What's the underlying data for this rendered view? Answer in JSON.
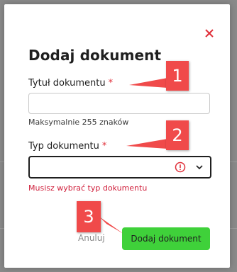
{
  "dialog": {
    "title": "Dodaj dokument",
    "close_icon": "close-icon",
    "fields": {
      "document_title": {
        "label": "Tytuł dokumentu",
        "required_mark": "*",
        "value": "",
        "hint": "Maksymalnie 255 znaków"
      },
      "document_type": {
        "label": "Typ dokumentu",
        "required_mark": "*",
        "selected_value": "",
        "error_icon": "exclamation-circle-icon",
        "dropdown_icon": "chevron-down-icon",
        "error_message": "Musisz wybrać typ dokumentu"
      }
    },
    "actions": {
      "cancel_label": "Anuluj",
      "submit_label": "Dodaj dokument"
    }
  },
  "annotations": [
    {
      "number": "1"
    },
    {
      "number": "2"
    },
    {
      "number": "3"
    }
  ],
  "colors": {
    "required": "#e0303a",
    "error": "#d0203c",
    "submit_bg": "#3fd13a",
    "callout": "#f04a4a",
    "close_icon": "#e0303a"
  }
}
